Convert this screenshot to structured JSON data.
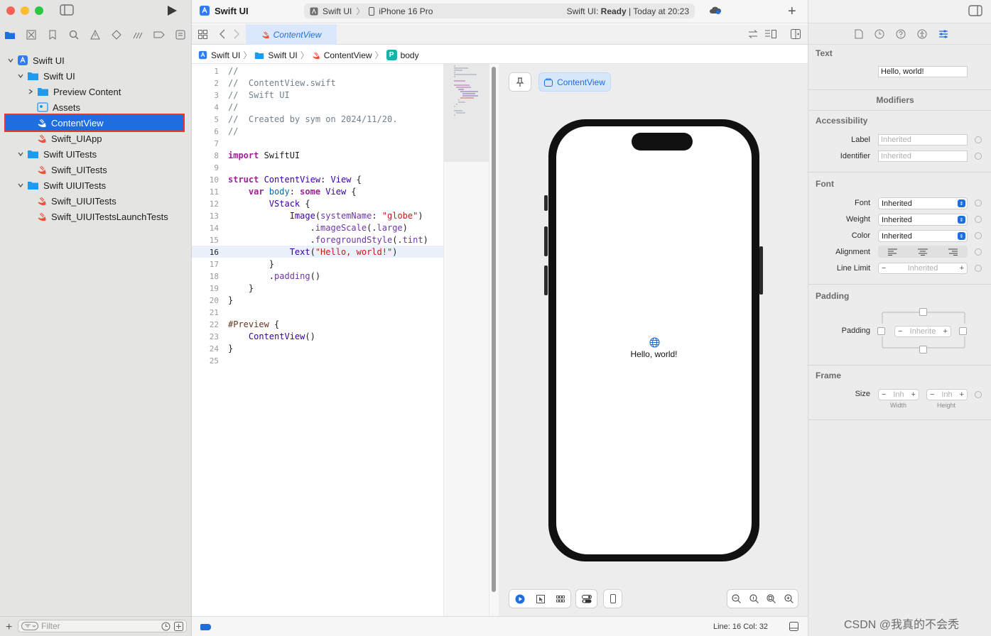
{
  "window": {
    "project_title": "Swift UI",
    "scheme_project": "Swift UI",
    "scheme_device": "iPhone 16 Pro",
    "status_prefix": "Swift UI:",
    "status_state": "Ready",
    "status_time": "| Today at 20:23"
  },
  "navigator": {
    "items": [
      {
        "label": "Swift UI"
      },
      {
        "label": "Swift UI"
      },
      {
        "label": "Preview Content"
      },
      {
        "label": "Assets"
      },
      {
        "label": "ContentView"
      },
      {
        "label": "Swift_UIApp"
      },
      {
        "label": "Swift UITests"
      },
      {
        "label": "Swift_UITests"
      },
      {
        "label": "Swift UIUITests"
      },
      {
        "label": "Swift_UIUITests"
      },
      {
        "label": "Swift_UIUITestsLaunchTests"
      }
    ],
    "filter_placeholder": "Filter"
  },
  "tab": {
    "label": "ContentView"
  },
  "jumpbar": {
    "c1": "Swift UI",
    "c2": "Swift UI",
    "c3": "ContentView",
    "c4": "body",
    "c4_badge": "P"
  },
  "code": {
    "current_line": "16",
    "lines": [
      {
        "n": "1"
      },
      {
        "n": "2"
      },
      {
        "n": "3"
      },
      {
        "n": "4"
      },
      {
        "n": "5"
      },
      {
        "n": "6"
      },
      {
        "n": "7"
      },
      {
        "n": "8"
      },
      {
        "n": "9"
      },
      {
        "n": "10"
      },
      {
        "n": "11"
      },
      {
        "n": "12"
      },
      {
        "n": "13"
      },
      {
        "n": "14"
      },
      {
        "n": "15"
      },
      {
        "n": "16"
      },
      {
        "n": "17"
      },
      {
        "n": "18"
      },
      {
        "n": "19"
      },
      {
        "n": "20"
      },
      {
        "n": "21"
      },
      {
        "n": "22"
      },
      {
        "n": "23"
      },
      {
        "n": "24"
      },
      {
        "n": "25"
      }
    ],
    "t": {
      "l1": "//",
      "l2": "//  ContentView.swift",
      "l3": "//  Swift UI",
      "l4": "//",
      "l5": "//  Created by sym on 2024/11/20.",
      "l6": "//",
      "import_kw": "import",
      "import_mod": " SwiftUI",
      "struct_kw": "struct",
      "struct_name": " ContentView",
      "colon": ": ",
      "view_ty": "View",
      "brace_open": " {",
      "var_kw": "    var",
      "body_name": " body",
      "colon2": ": ",
      "some_kw": "some",
      "view_ty2": " View",
      "brace_open2": " {",
      "vstack": "        VStack",
      "brace_open3": " {",
      "image": "            Image",
      "paren_open": "(",
      "sysname": "systemName",
      "colon3": ": ",
      "globe": "\"globe\"",
      "paren_close": ")",
      "dot1": "                .",
      "imageScale": "imageScale",
      "arg1": "(.",
      "large": "large",
      "close1": ")",
      "dot2": "                .",
      "fgStyle": "foregroundStyle",
      "arg2": "(.",
      "tint": "tint",
      "close2": ")",
      "text": "            Text",
      "paren_open2": "(",
      "hello": "\"Hello, world!\"",
      "paren_close2": ")",
      "l17": "        }",
      "dot3": "        .",
      "padding": "padding",
      "paren3": "()",
      "l19": "    }",
      "l20": "}",
      "preview_kw": "#Preview",
      "brace_open4": " {",
      "cv_call": "    ContentView",
      "paren4": "()",
      "l24": "}"
    }
  },
  "preview": {
    "chip_label": "ContentView",
    "text": "Hello, world!"
  },
  "status": {
    "line_col": "Line: 16  Col: 32"
  },
  "inspector": {
    "text_title": "Text",
    "text_value": "Hello, world!",
    "modifiers_title": "Modifiers",
    "accessibility_title": "Accessibility",
    "label_label": "Label",
    "label_placeholder": "Inherited",
    "identifier_label": "Identifier",
    "identifier_placeholder": "Inherited",
    "font_title": "Font",
    "font_label": "Font",
    "font_value": "Inherited",
    "weight_label": "Weight",
    "weight_value": "Inherited",
    "color_label": "Color",
    "color_value": "Inherited",
    "alignment_label": "Alignment",
    "line_limit_label": "Line Limit",
    "line_limit_value": "Inherited",
    "padding_title": "Padding",
    "padding_label": "Padding",
    "padding_value": "Inherite",
    "frame_title": "Frame",
    "size_label": "Size",
    "width_value": "Inh",
    "height_value": "Inh",
    "width_caption": "Width",
    "height_caption": "Height",
    "minus": "−",
    "plus": "+"
  },
  "watermark": "CSDN @我真的不会秃",
  "colors": {
    "accent": "#1d6fe0",
    "selection_outline": "#e53a2b",
    "swift_orange": "#f05138"
  }
}
